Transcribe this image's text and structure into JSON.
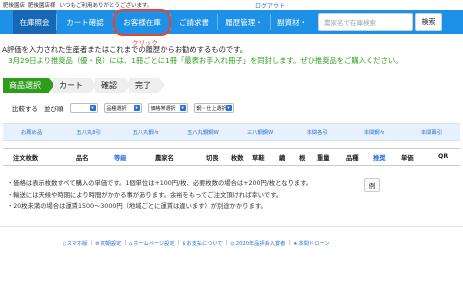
{
  "topbar": {
    "shop": "肥後園店",
    "greeting": "いつもご利用ありがとうございます。",
    "suffix": "様",
    "logout": "ログアウト"
  },
  "nav": {
    "items": [
      "在庫照会",
      "カート確認",
      "お客様在庫",
      "ご請求書",
      "履歴管理・",
      "副資材・"
    ],
    "search_placeholder": "農家名で在庫検索",
    "search_button": "検索"
  },
  "annotation": {
    "click_label": "クリック"
  },
  "notices": {
    "line1": "A評価を入力された生産者またはこれまでの履歴からお勧めするものです。",
    "line2_prefix": "3月29日より推奨品（優・良）には、1冊ごとに1冊「最表お手入れ冊子」を同封します。ぜひ推奨品をご購入ください。"
  },
  "steps": [
    "商品選択",
    "カート",
    "確認",
    "完了"
  ],
  "filters": {
    "compare_label": "比較する",
    "sort_label": "並び順",
    "selects": [
      "",
      "品種選択",
      "価格帯選択",
      "鋼・仕上選択"
    ]
  },
  "sortbar": [
    "お薦め品",
    "五八丸8引",
    "五八丸鋼々",
    "五八丸鋼鋼W",
    "三八鋼鋼W",
    "本間各引",
    "本間鋼々",
    "本間幕引"
  ],
  "table_headers": [
    "注文枚数",
    "品名",
    "等級",
    "農家名",
    "切畏",
    "枚数",
    "草鞋",
    "織",
    "根",
    "重量",
    "品種",
    "推奨",
    "単価",
    "QR"
  ],
  "info_lines": [
    "・価格は表示枚数すべて購入の単価です。1個単位は+100円/枚、必要枚数の場合は+200円/枚となります。",
    "・輸送には天候や時期により時間がかかる事があります。余裕をもってご注文頂ければ幸いです。",
    "・20枚未満の場合は運賃1500〜3000円（地域ごとに運賃は違います）が別途かかります。"
  ],
  "example_button": "例",
  "footer": [
    {
      "icon": "phone-icon",
      "label": "スマホ版"
    },
    {
      "icon": "settings-icon",
      "label": "初期設定"
    },
    {
      "icon": "home-icon",
      "label": "ホームページ設定"
    },
    {
      "icon": "money-icon",
      "label": "お支払について"
    },
    {
      "icon": "award-icon",
      "label": "2020年品評会入賞者"
    },
    {
      "icon": "star-icon",
      "label": "本間ドローン"
    }
  ],
  "colors": {
    "nav_blue": "#1e90e6",
    "nav_active": "#1668b6",
    "green": "#2e9d1c",
    "link": "#2a6fdb",
    "highlight": "#e8452c"
  }
}
